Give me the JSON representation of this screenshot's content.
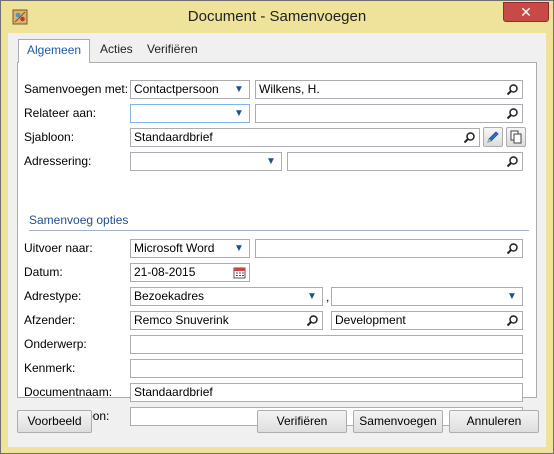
{
  "window": {
    "title": "Document - Samenvoegen",
    "close_glyph": "✕"
  },
  "tabs": [
    {
      "label": "Algemeen"
    },
    {
      "label": "Acties"
    },
    {
      "label": "Verifiëren"
    }
  ],
  "form": {
    "merge_with": {
      "label": "Samenvoegen met:",
      "type_value": "Contactpersoon",
      "search_value": "Wilkens, H."
    },
    "relate_to": {
      "label": "Relateer aan:",
      "type_value": "",
      "search_value": ""
    },
    "template": {
      "label": "Sjabloon:",
      "value": "Standaardbrief"
    },
    "addressing": {
      "label": "Adressering:",
      "value": "",
      "value2": ""
    }
  },
  "merge_options": {
    "heading": "Samenvoeg opties",
    "output_to": {
      "label": "Uitvoer naar:",
      "value": "Microsoft Word",
      "search_value": ""
    },
    "date": {
      "label": "Datum:",
      "value": "21-08-2015"
    },
    "address_type": {
      "label": "Adrestype:",
      "value": "Bezoekadres",
      "separator": ",",
      "value2": ""
    },
    "sender": {
      "label": "Afzender:",
      "value": "Remco Snuverink",
      "department": "Development"
    },
    "subject": {
      "label": "Onderwerp:",
      "value": ""
    },
    "reference": {
      "label": "Kenmerk:",
      "value": ""
    },
    "document_name": {
      "label": "Documentnaam:",
      "value": "Standaardbrief"
    },
    "email_template": {
      "label": "E-mail sjabloon:",
      "value": ""
    }
  },
  "buttons": {
    "preview": "Voorbeeld",
    "verify": "Verifiëren",
    "merge": "Samenvoegen",
    "cancel": "Annuleren"
  },
  "icons": {
    "dropdown": "chevron-down-icon",
    "search": "search-icon",
    "calendar": "calendar-icon",
    "edit": "pencil-icon",
    "copy": "copy-icon"
  },
  "colors": {
    "titlebar": "#efe29a",
    "close": "#c74a47",
    "accent": "#1f4e8c"
  }
}
